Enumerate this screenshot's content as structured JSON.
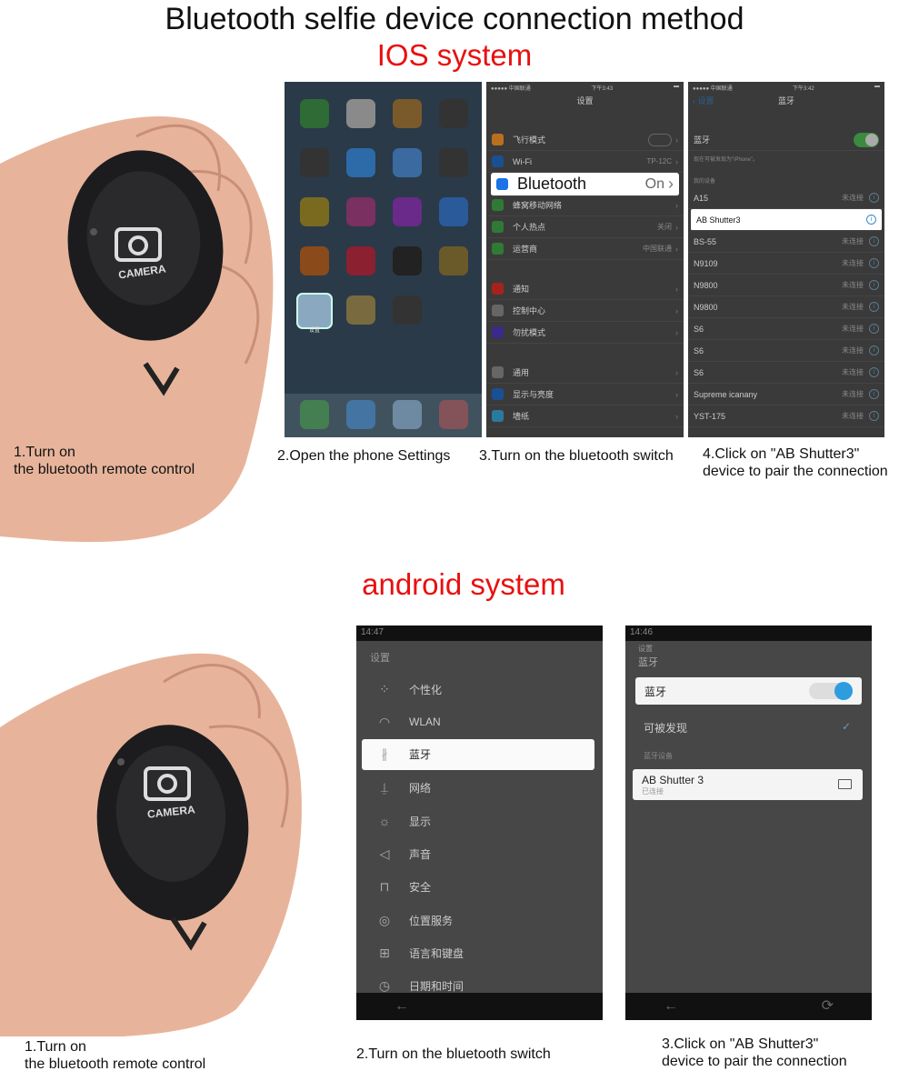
{
  "title": "Bluetooth selfie device connection method",
  "ios": {
    "heading": "IOS system",
    "step1": "1.Turn on\nthe bluetooth remote control",
    "step2": "2.Open the phone Settings",
    "step3": "3.Turn on the bluetooth switch",
    "step4": "4.Click on \"AB Shutter3\"\ndevice to pair the connection",
    "remote_label": "CAMERA",
    "home": {
      "settings_label": "设置"
    },
    "settings": {
      "carrier": "●●●●● 中国联通",
      "time": "下午3:43",
      "title": "设置",
      "items": [
        {
          "label": "飞行模式",
          "value": "",
          "color": "#b8701e"
        },
        {
          "label": "Wi-Fi",
          "value": "TP-12C",
          "color": "#1b4f93"
        },
        {
          "label": "Bluetooth",
          "value": "On",
          "color": "#1a73e8"
        },
        {
          "label": "蜂窝移动网络",
          "value": "",
          "color": "#2f7a34"
        },
        {
          "label": "个人热点",
          "value": "关闭",
          "color": "#2f7a34"
        },
        {
          "label": "运营商",
          "value": "中国联通",
          "color": "#2f7a34"
        },
        {
          "label": "通知",
          "value": "",
          "color": "#a8221d"
        },
        {
          "label": "控制中心",
          "value": "",
          "color": "#666666"
        },
        {
          "label": "勿扰模式",
          "value": "",
          "color": "#3b2a8a"
        },
        {
          "label": "通用",
          "value": "",
          "color": "#666666"
        },
        {
          "label": "显示与亮度",
          "value": "",
          "color": "#1b4f93"
        },
        {
          "label": "墙纸",
          "value": "",
          "color": "#2a7aa0"
        }
      ]
    },
    "bluetooth": {
      "carrier": "●●●●● 中国联通",
      "time": "下午3:42",
      "back": "设置",
      "title": "蓝牙",
      "toggle_label": "蓝牙",
      "discoverable": "现在可被发现为\"iPhone\"。",
      "section": "我的设备",
      "status": "未连接",
      "devices": [
        "A15",
        "AB Shutter3",
        "BS-55",
        "N9109",
        "N9800",
        "N9800",
        "S6",
        "S6",
        "S6",
        "Supreme icanany",
        "YST-175"
      ]
    }
  },
  "android": {
    "heading": "android system",
    "step1": "1.Turn on\nthe bluetooth remote control",
    "step2": "2.Turn on the bluetooth switch",
    "step3": "3.Click on \"AB Shutter3\"\ndevice to pair the connection",
    "remote_label": "CAMERA",
    "settings": {
      "time": "14:47",
      "title": "设置",
      "items": [
        {
          "label": "个性化",
          "icon": "⁘"
        },
        {
          "label": "WLAN",
          "icon": "◠"
        },
        {
          "label": "蓝牙",
          "icon": "∦"
        },
        {
          "label": "网络",
          "icon": "⍊"
        },
        {
          "label": "显示",
          "icon": "☼"
        },
        {
          "label": "声音",
          "icon": "◁"
        },
        {
          "label": "安全",
          "icon": "⊓"
        },
        {
          "label": "位置服务",
          "icon": "◎"
        },
        {
          "label": "语言和键盘",
          "icon": "⊞"
        },
        {
          "label": "日期和时间",
          "icon": "◷"
        }
      ]
    },
    "bluetooth": {
      "time": "14:46",
      "parent": "设置",
      "title": "蓝牙",
      "toggle_label": "蓝牙",
      "discoverable": "可被发现",
      "section": "蓝牙设备",
      "device": "AB Shutter 3",
      "device_status": "已连接"
    }
  }
}
